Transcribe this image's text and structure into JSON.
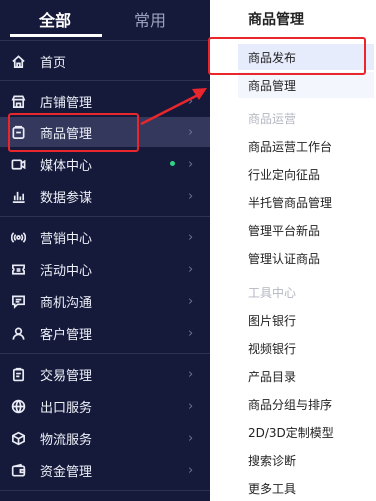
{
  "sidebar": {
    "tabs": [
      {
        "label": "全部",
        "active": true
      },
      {
        "label": "常用",
        "active": false
      }
    ],
    "items": [
      {
        "label": "首页",
        "icon": "home-icon",
        "arrow": false
      },
      {
        "label": "店铺管理",
        "icon": "store-icon",
        "arrow": true
      },
      {
        "label": "商品管理",
        "icon": "goods-icon",
        "arrow": true,
        "selected": true
      },
      {
        "label": "媒体中心",
        "icon": "media-icon",
        "arrow": true,
        "dot": true
      },
      {
        "label": "数据参谋",
        "icon": "bar-chart-icon",
        "arrow": true
      },
      {
        "label": "营销中心",
        "icon": "broadcast-icon",
        "arrow": true
      },
      {
        "label": "活动中心",
        "icon": "ticket-icon",
        "arrow": true
      },
      {
        "label": "商机沟通",
        "icon": "chat-icon",
        "arrow": true
      },
      {
        "label": "客户管理",
        "icon": "user-icon",
        "arrow": true
      },
      {
        "label": "交易管理",
        "icon": "clipboard-icon",
        "arrow": true
      },
      {
        "label": "出口服务",
        "icon": "globe-icon",
        "arrow": true
      },
      {
        "label": "物流服务",
        "icon": "package-icon",
        "arrow": true
      },
      {
        "label": "资金管理",
        "icon": "wallet-icon",
        "arrow": true
      }
    ],
    "arrow_glyph": "›"
  },
  "panel": {
    "title": "商品管理",
    "items": [
      {
        "label": "商品发布",
        "state": "active"
      },
      {
        "label": "商品管理",
        "state": "sub"
      }
    ],
    "section1": {
      "heading": "商品运营",
      "items": [
        "商品运营工作台",
        "行业定向征品",
        "半托管商品管理",
        "管理平台新品",
        "管理认证商品"
      ]
    },
    "section2": {
      "heading": "工具中心",
      "items": [
        "图片银行",
        "视频银行",
        "产品目录",
        "商品分组与排序",
        "2D/3D定制模型",
        "搜索诊断",
        "更多工具"
      ]
    }
  },
  "colors": {
    "sidebar_bg": "#161a3a",
    "highlight_bg": "#33385c",
    "annotation_red": "#e8262c",
    "active_item_bg": "#e6ecfb",
    "status_dot": "#2fd486"
  }
}
